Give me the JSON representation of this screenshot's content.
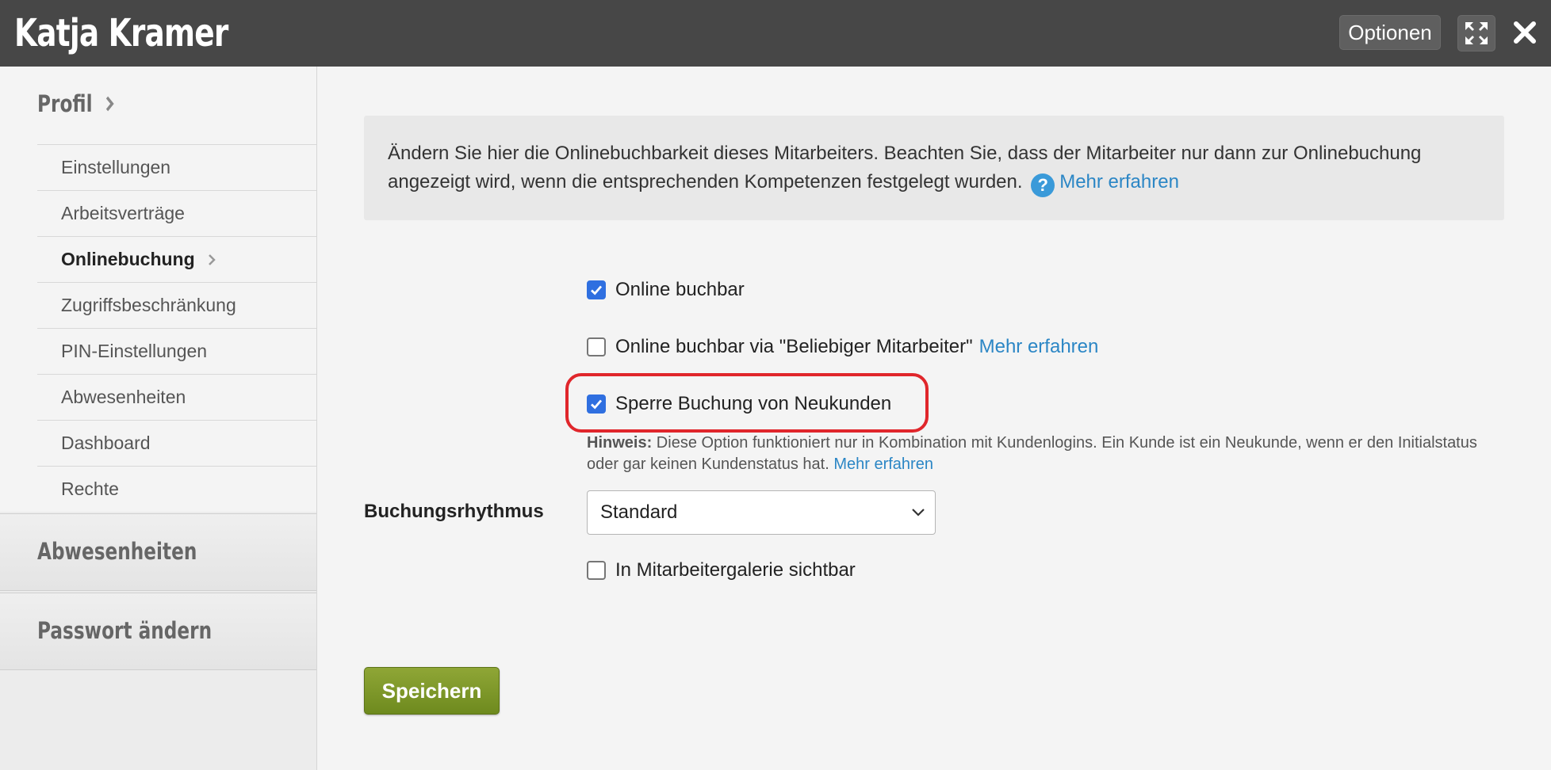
{
  "window": {
    "title": "Katja Kramer",
    "options_label": "Optionen",
    "expand_icon": "expand-icon",
    "close_icon": "close-icon"
  },
  "sidebar": {
    "profile_heading": "Profil",
    "items": [
      {
        "label": "Einstellungen"
      },
      {
        "label": "Arbeitsverträge"
      },
      {
        "label": "Onlinebuchung",
        "active": true
      },
      {
        "label": "Zugriffsbeschränkung"
      },
      {
        "label": "PIN-Einstellungen"
      },
      {
        "label": "Abwesenheiten"
      },
      {
        "label": "Dashboard"
      },
      {
        "label": "Rechte"
      }
    ],
    "sections": [
      {
        "label": "Abwesenheiten"
      },
      {
        "label": "Passwort ändern"
      }
    ]
  },
  "main": {
    "info_text": "Ändern Sie hier die Onlinebuchbarkeit dieses Mitarbeiters. Beachten Sie, dass der Mitarbeiter nur dann zur Onlinebuchung angezeigt wird, wenn die entsprechenden Kompetenzen festgelegt wurden.",
    "info_help_glyph": "?",
    "info_link": "Mehr erfahren",
    "options": [
      {
        "label": "Online buchbar",
        "checked": true
      },
      {
        "label": "Online buchbar via \"Beliebiger Mitarbeiter\"",
        "checked": false,
        "link": "Mehr erfahren"
      },
      {
        "label": "Sperre Buchung von Neukunden",
        "checked": true
      }
    ],
    "hint_label": "Hinweis:",
    "hint_text": " Diese Option funktioniert nur in Kombination mit Kundenlogins. Ein Kunde ist ein Neukunde, wenn er den Initialstatus oder gar keinen Kundenstatus hat. ",
    "hint_link": "Mehr erfahren",
    "rhythm_label": "Buchungsrhythmus",
    "rhythm_value": "Standard",
    "gallery_label": "In Mitarbeitergalerie sichtbar",
    "gallery_checked": false,
    "save_label": "Speichern"
  },
  "colors": {
    "titlebar": "#474747",
    "link": "#2b86c5",
    "checkbox_checked": "#2f6fe0",
    "highlight_border": "#e0262b",
    "save_button": "#7a9428"
  }
}
